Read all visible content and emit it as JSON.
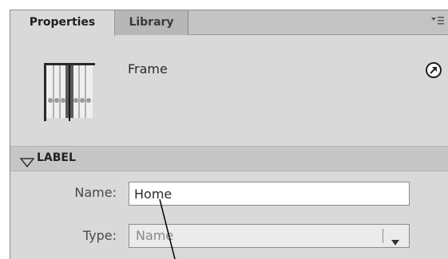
{
  "tabs": [
    {
      "label": "Properties",
      "active": true
    },
    {
      "label": "Library",
      "active": false
    }
  ],
  "panel_menu_icon": "panel-menu-icon",
  "header": {
    "symbol_icon": "frame-icon",
    "symbol_type": "Frame",
    "goto_icon": "goto-arrow-icon"
  },
  "label_section": {
    "title": "LABEL",
    "expanded": true,
    "name_label": "Name:",
    "name_value": "Home",
    "type_label": "Type:",
    "type_value": "Name"
  },
  "colors": {
    "panel_bg": "#d9d9d9",
    "tabbar_bg": "#c3c3c3",
    "section_header_bg": "#c6c6c6",
    "input_bg": "#ffffff"
  }
}
